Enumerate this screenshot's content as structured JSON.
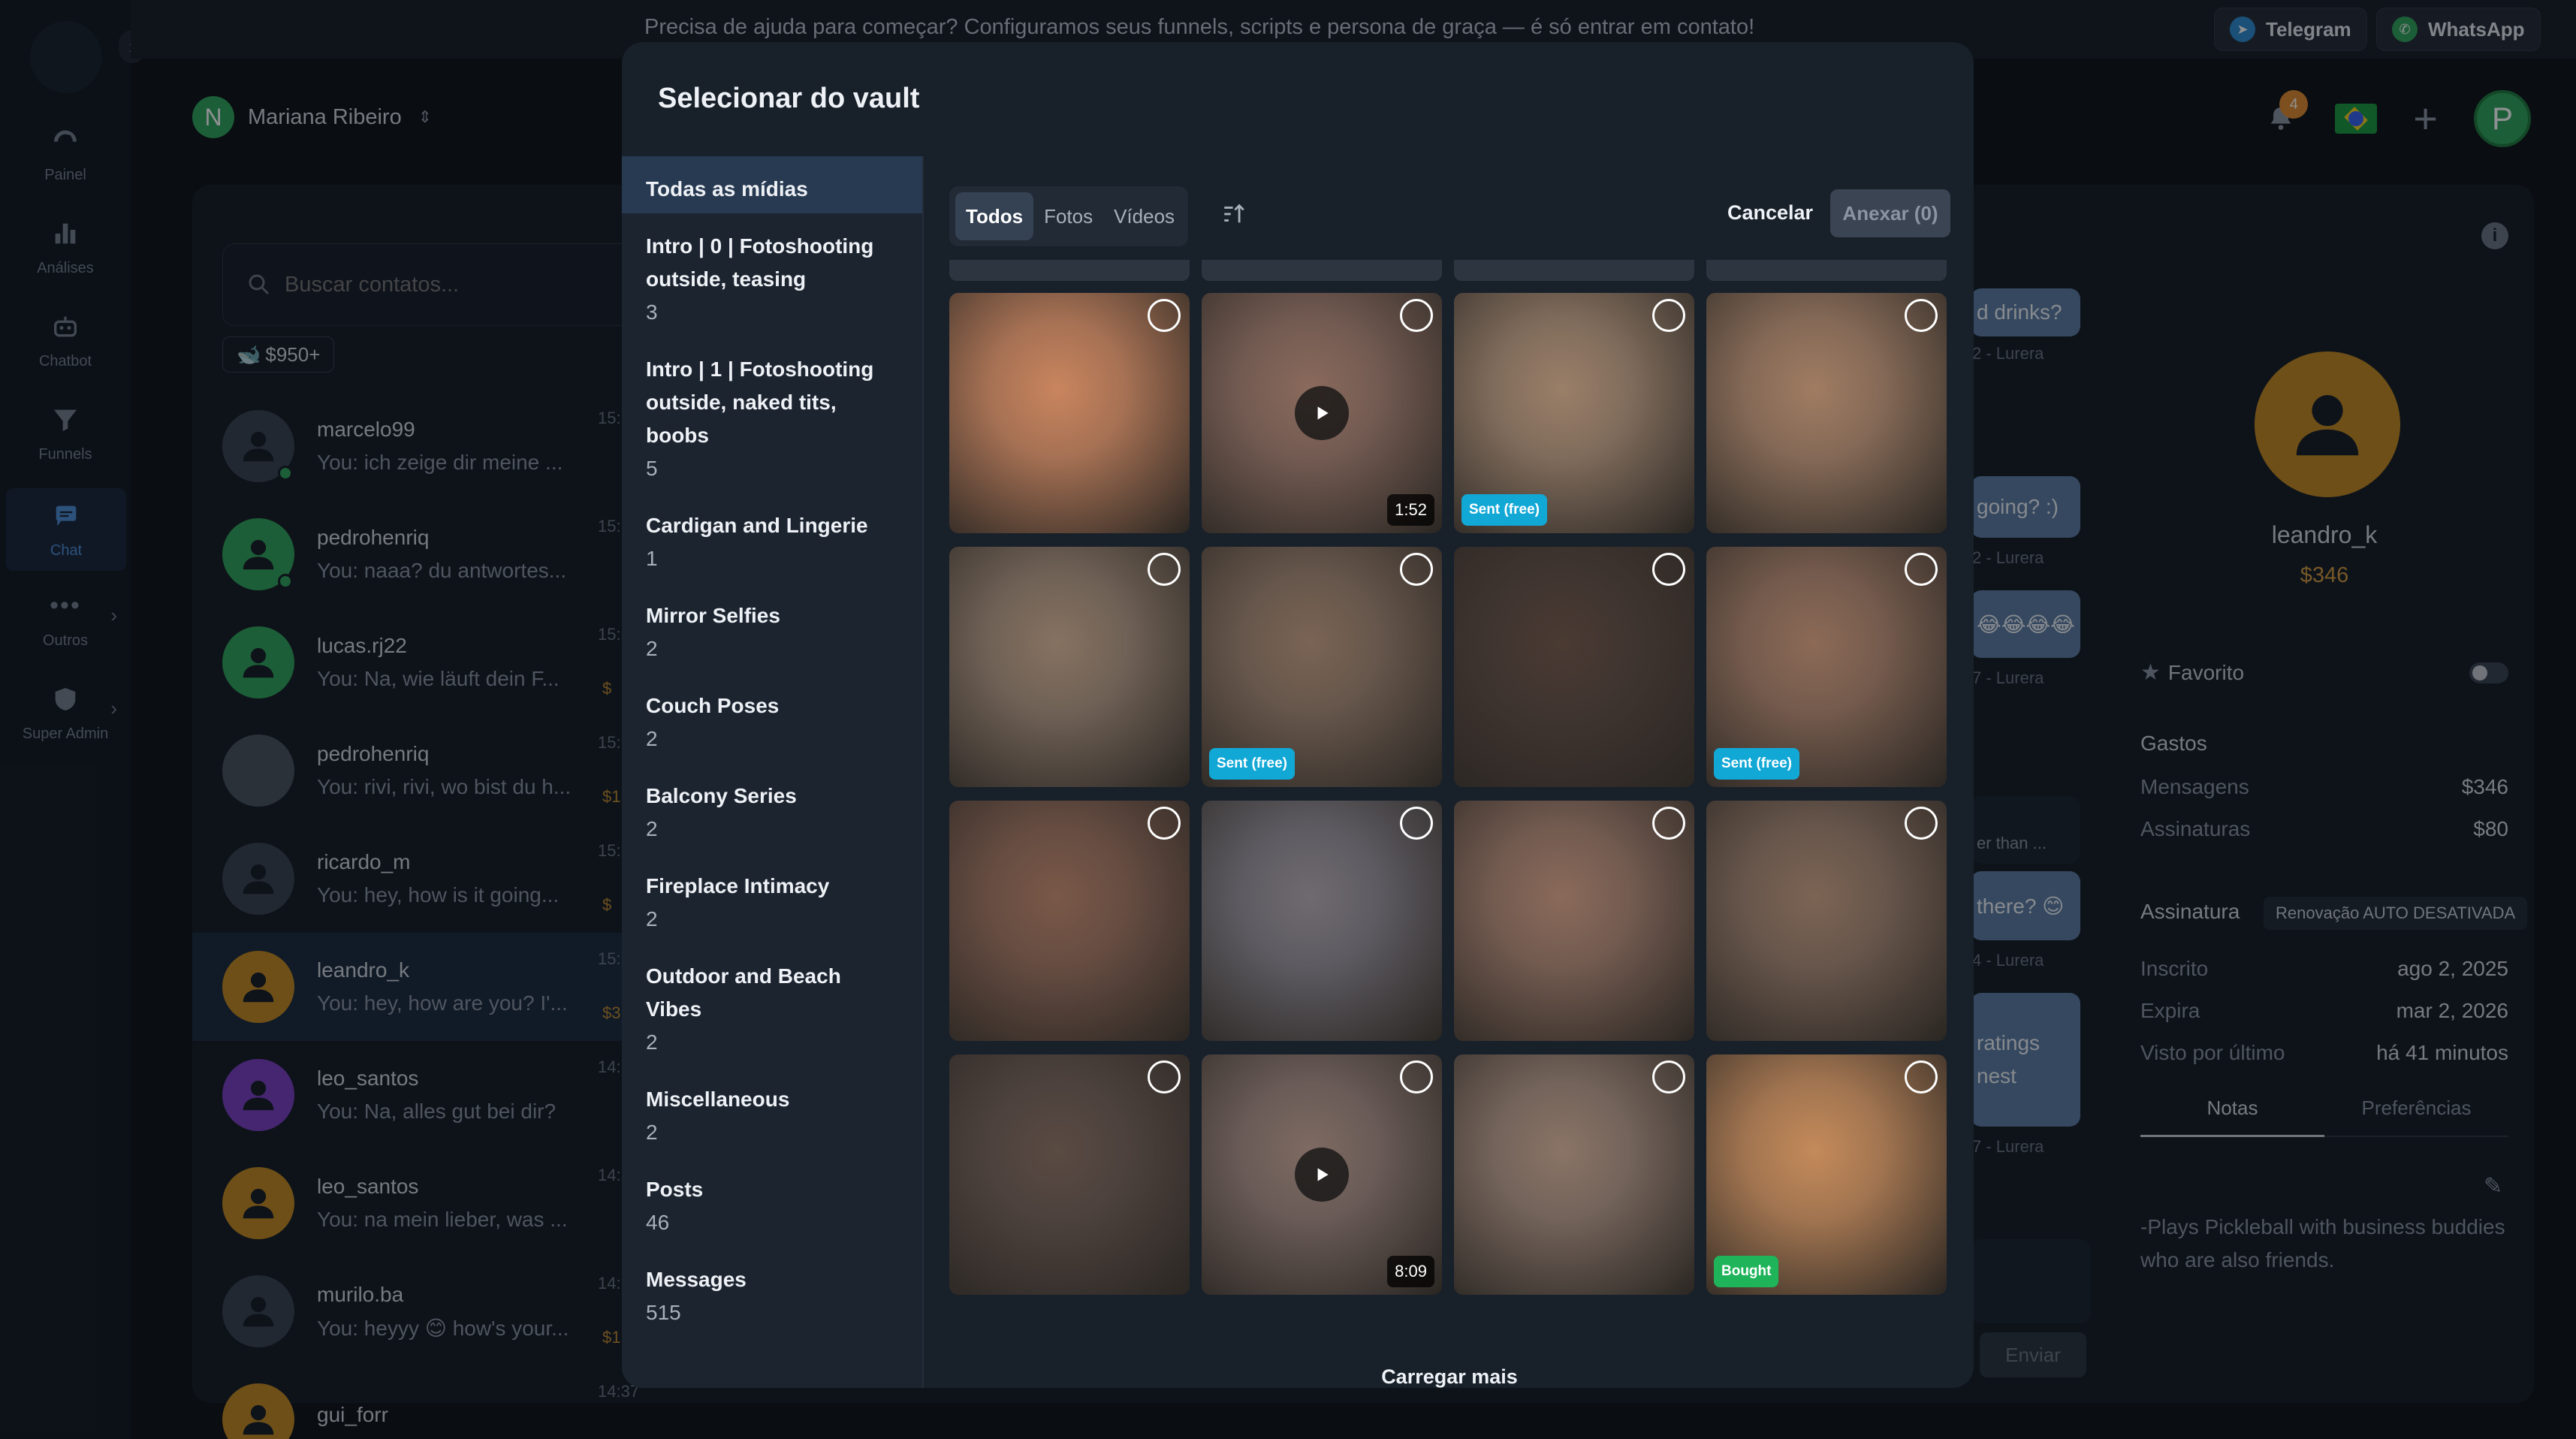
{
  "banner": {
    "text": "Precisa de ajuda para começar? Configuramos seus funnels, scripts e persona de graça — é só entrar em contato!",
    "telegram": "Telegram",
    "whatsapp": "WhatsApp"
  },
  "rail": {
    "items": [
      {
        "label": "Painel",
        "icon": "gauge-icon"
      },
      {
        "label": "Análises",
        "icon": "bar-chart-icon"
      },
      {
        "label": "Chatbot",
        "icon": "robot-icon"
      },
      {
        "label": "Funnels",
        "icon": "funnel-icon"
      },
      {
        "label": "Chat",
        "icon": "chat-icon"
      },
      {
        "label": "Outros",
        "icon": "more-icon"
      },
      {
        "label": "Super Admin",
        "icon": "shield-icon"
      }
    ]
  },
  "header": {
    "account_initial": "N",
    "account_name": "Mariana Ribeiro",
    "notification_count": "4",
    "profile_initial": "P"
  },
  "contacts_panel": {
    "search_placeholder": "Buscar contatos...",
    "filter_chip": "$950+",
    "contacts": [
      {
        "name": "marcelo99",
        "message": "You: ich zeige dir meine ...",
        "time": "15:",
        "amount": "",
        "avatar_color": "#3a4350",
        "online": true
      },
      {
        "name": "pedrohenriq",
        "message": "You: naaa? du antwortes...",
        "time": "15:",
        "amount": "",
        "avatar_color": "#2fa55a",
        "online": true
      },
      {
        "name": "lucas.rj22",
        "message": "You: Na, wie läuft dein F...",
        "time": "15:",
        "amount": "$",
        "avatar_color": "#2fa55a",
        "online": false
      },
      {
        "name": "pedrohenriq",
        "message": "You: rivi, rivi, wo bist du h...",
        "time": "15:",
        "amount": "$1",
        "avatar_color": "#4a525c",
        "online": false
      },
      {
        "name": "ricardo_m",
        "message": "You: hey, how is it going...",
        "time": "15:",
        "amount": "$",
        "avatar_color": "#3a4350",
        "online": false
      },
      {
        "name": "leandro_k",
        "message": "You: hey, how are you? I'...",
        "time": "15:",
        "amount": "$3",
        "avatar_color": "#c4891f",
        "online": false
      },
      {
        "name": "leo_santos",
        "message": "You: Na, alles gut bei dir?",
        "time": "14:",
        "amount": "",
        "avatar_color": "#7a3fc4",
        "online": false
      },
      {
        "name": "leo_santos",
        "message": "You: na mein lieber, was ...",
        "time": "14:",
        "amount": "",
        "avatar_color": "#c4891f",
        "online": false
      },
      {
        "name": "murilo.ba",
        "message": "You: heyyy 😊 how's your...",
        "time": "14:",
        "amount": "$1",
        "avatar_color": "#3a4350",
        "online": false
      },
      {
        "name": "gui_forr",
        "message": "",
        "time": "14:37",
        "amount": "",
        "avatar_color": "#c4891f",
        "online": false
      }
    ]
  },
  "chat_fragments": {
    "bubble_1": "d drinks?",
    "meta_1": "2 - Lurera",
    "bubble_2": "going? :)",
    "meta_2": "2 - Lurera",
    "bubble_3": "😂😂😂😂",
    "meta_3": "7 - Lurera",
    "bubble_4": "er than ...",
    "bubble_5": "there? 😊",
    "meta_5": "4 - Lurera",
    "bubble_6a": "ratings",
    "bubble_6b": "nest",
    "meta_6": "7 - Lurera",
    "send_label": "Enviar"
  },
  "profile_panel": {
    "name": "leandro_k",
    "amount": "$346",
    "favorite_label": "Favorito",
    "spending_heading": "Gastos",
    "messages_label": "Mensagens",
    "messages_value": "$346",
    "subscriptions_label": "Assinaturas",
    "subscriptions_value": "$80",
    "subscription_heading": "Assinatura",
    "renewal_badge": "Renovação AUTO DESATIVADA",
    "subscribed_label": "Inscrito",
    "subscribed_value": "ago 2, 2025",
    "expires_label": "Expira",
    "expires_value": "mar 2, 2026",
    "last_seen_label": "Visto por último",
    "last_seen_value": "há 41 minutos",
    "tab_notes": "Notas",
    "tab_preferences": "Preferências",
    "notes_text": "-Plays Pickleball with business buddies who are also friends."
  },
  "modal": {
    "title": "Selecionar do vault",
    "categories": [
      {
        "name": "Todas as mídias",
        "count": "",
        "active": true
      },
      {
        "name": "Intro | 0 | Fotoshooting outside, teasing",
        "count": "3"
      },
      {
        "name": "Intro | 1 | Fotoshooting outside, naked tits, boobs",
        "count": "5"
      },
      {
        "name": "Cardigan and Lingerie",
        "count": "1"
      },
      {
        "name": "Mirror Selfies",
        "count": "2"
      },
      {
        "name": "Couch Poses",
        "count": "2"
      },
      {
        "name": "Balcony Series",
        "count": "2"
      },
      {
        "name": "Fireplace Intimacy",
        "count": "2"
      },
      {
        "name": "Outdoor and Beach Vibes",
        "count": "2"
      },
      {
        "name": "Miscellaneous",
        "count": "2"
      },
      {
        "name": "Posts",
        "count": "46"
      },
      {
        "name": "Messages",
        "count": "515"
      }
    ],
    "filters": [
      "Todos",
      "Fotos",
      "Vídeos"
    ],
    "active_filter": "Todos",
    "cancel_label": "Cancelar",
    "attach_label": "Anexar (0)",
    "load_more_label": "Carregar mais",
    "media": [
      {
        "tone": "#c9855e",
        "video": false,
        "duration": "",
        "tag": ""
      },
      {
        "tone": "#8a6a5c",
        "video": true,
        "duration": "1:52",
        "tag": ""
      },
      {
        "tone": "#9a7f68",
        "video": false,
        "duration": "",
        "tag": "Sent (free)"
      },
      {
        "tone": "#a07c62",
        "video": false,
        "duration": "",
        "tag": ""
      },
      {
        "tone": "#867261",
        "video": false,
        "duration": "",
        "tag": ""
      },
      {
        "tone": "#7a6454",
        "video": false,
        "duration": "",
        "tag": "Sent (free)"
      },
      {
        "tone": "#4a3a32",
        "video": false,
        "duration": "",
        "tag": ""
      },
      {
        "tone": "#8c6a56",
        "video": false,
        "duration": "",
        "tag": "Sent (free)"
      },
      {
        "tone": "#7a5848",
        "video": false,
        "duration": "",
        "tag": ""
      },
      {
        "tone": "#6f6a70",
        "video": false,
        "duration": "",
        "tag": ""
      },
      {
        "tone": "#8a6a5a",
        "video": false,
        "duration": "",
        "tag": ""
      },
      {
        "tone": "#7c6454",
        "video": false,
        "duration": "",
        "tag": ""
      },
      {
        "tone": "#5a4a42",
        "video": false,
        "duration": "",
        "tag": ""
      },
      {
        "tone": "#7e6a62",
        "video": true,
        "duration": "8:09",
        "tag": ""
      },
      {
        "tone": "#8a7466",
        "video": false,
        "duration": "",
        "tag": ""
      },
      {
        "tone": "#c48a5a",
        "video": false,
        "duration": "",
        "tag": "Bought"
      }
    ]
  },
  "colors": {
    "accent_blue": "#4c8fd8",
    "sent_tag": "#12a8d6",
    "bought_tag": "#1fb45a",
    "gold": "#c4891f"
  }
}
